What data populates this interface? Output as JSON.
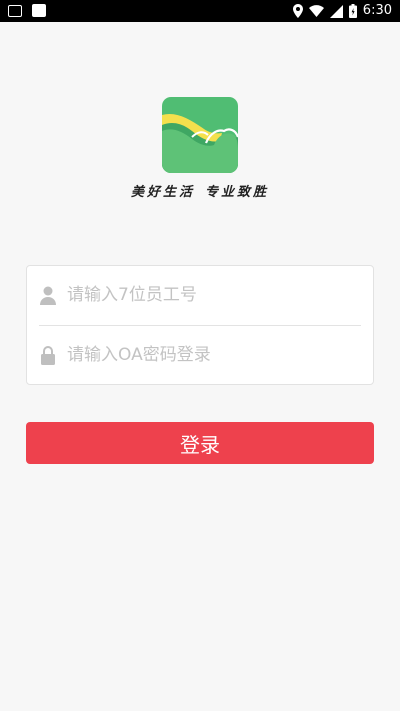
{
  "status_bar": {
    "time": "6:30",
    "icons": [
      "keyboard-icon",
      "image-icon",
      "location-icon",
      "wifi-icon",
      "signal-icon",
      "battery-icon"
    ]
  },
  "brand": {
    "logo": "landscape-logo",
    "slogan_left": "美好生活",
    "slogan_right": "专业致胜"
  },
  "login_form": {
    "employee_id_placeholder": "请输入7位员工号",
    "employee_id_value": "",
    "password_placeholder": "请输入OA密码登录",
    "password_value": "",
    "user_icon": "user-icon",
    "lock_icon": "lock-icon"
  },
  "actions": {
    "login_label": "登录"
  },
  "colors": {
    "primary_button": "#ee414d",
    "background": "#f7f7f7",
    "logo_green": "#5ec277",
    "logo_yellow": "#f4e04d"
  }
}
